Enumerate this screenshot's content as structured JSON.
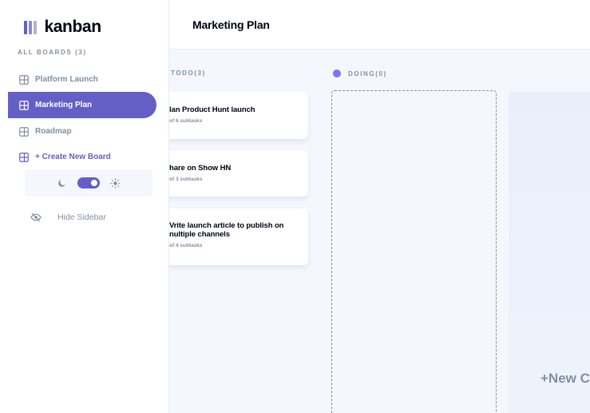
{
  "app": {
    "logo_text": "kanban"
  },
  "sidebar": {
    "section_title": "ALL BOARDS (3)",
    "boards": [
      {
        "label": "Platform Launch",
        "active": false
      },
      {
        "label": "Marketing Plan",
        "active": true
      },
      {
        "label": "Roadmap",
        "active": false
      }
    ],
    "create_label": "+ Create New Board",
    "theme": {
      "mode": "dark-toggle-on",
      "moon_icon": "moon-icon",
      "sun_icon": "sun-icon"
    },
    "hide_label": "Hide Sidebar"
  },
  "header": {
    "board_title": "Marketing Plan"
  },
  "columns": [
    {
      "title": "TODO(3)",
      "color": "#49c4e5",
      "tasks": [
        {
          "title": "lan Product Hunt launch",
          "subtasks": "of 6 subtasks"
        },
        {
          "title": "hare on Show HN",
          "subtasks": "of 3 subtasks"
        },
        {
          "title_line1": "Vrite launch article to publish on",
          "title_line2": "nultiple channels",
          "subtasks": "of 4 subtasks"
        }
      ]
    },
    {
      "title": "DOING(0)",
      "color": "#8471f2",
      "tasks": []
    }
  ],
  "new_column_label": "+New C",
  "colors": {
    "accent": "#635fc7",
    "text": "#000112",
    "muted": "#828fa3",
    "board_bg": "#f4f7fd"
  }
}
